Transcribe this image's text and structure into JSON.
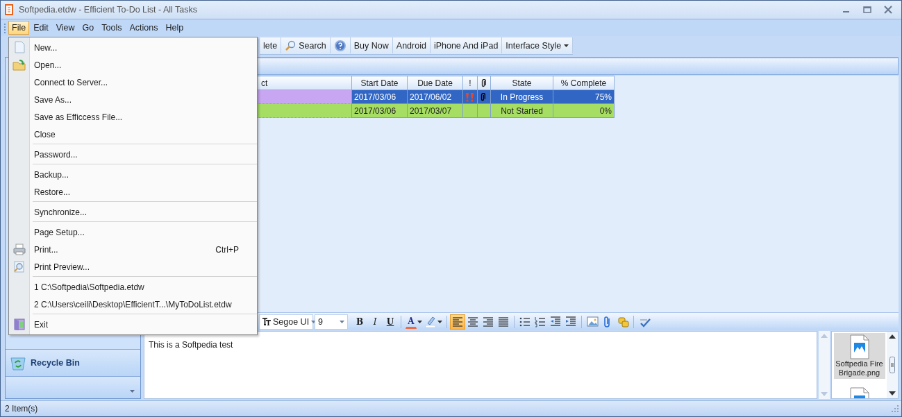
{
  "window": {
    "title": "Softpedia.etdw - Efficient To-Do List - All Tasks"
  },
  "menu_bar": [
    {
      "label": "File",
      "selected": true
    },
    {
      "label": "Edit",
      "selected": false
    },
    {
      "label": "View",
      "selected": false
    },
    {
      "label": "Go",
      "selected": false
    },
    {
      "label": "Tools",
      "selected": false
    },
    {
      "label": "Actions",
      "selected": false
    },
    {
      "label": "Help",
      "selected": false
    }
  ],
  "toolbar": [
    {
      "kind": "text",
      "label": "lete"
    },
    {
      "kind": "icon-text",
      "label": "Search"
    },
    {
      "kind": "icon"
    },
    {
      "kind": "text",
      "label": "Buy Now"
    },
    {
      "kind": "text",
      "label": "Android"
    },
    {
      "kind": "text",
      "label": "iPhone And iPad"
    },
    {
      "kind": "dropdown",
      "label": "Interface Style"
    }
  ],
  "file_menu": [
    {
      "kind": "item",
      "label": "New..."
    },
    {
      "kind": "item",
      "label": "Open..."
    },
    {
      "kind": "item",
      "label": "Connect to Server..."
    },
    {
      "kind": "item",
      "label": "Save As..."
    },
    {
      "kind": "item",
      "label": "Save as Efficcess File..."
    },
    {
      "kind": "item",
      "label": "Close"
    },
    {
      "kind": "separator"
    },
    {
      "kind": "item",
      "label": "Password..."
    },
    {
      "kind": "separator"
    },
    {
      "kind": "item",
      "label": "Backup..."
    },
    {
      "kind": "item",
      "label": "Restore..."
    },
    {
      "kind": "separator"
    },
    {
      "kind": "item",
      "label": "Synchronize..."
    },
    {
      "kind": "separator"
    },
    {
      "kind": "item",
      "label": "Page Setup..."
    },
    {
      "kind": "item",
      "label": "Print...",
      "shortcut": "Ctrl+P"
    },
    {
      "kind": "item",
      "label": "Print Preview..."
    },
    {
      "kind": "separator"
    },
    {
      "kind": "item",
      "label": "1 C:\\Softpedia\\Softpedia.etdw"
    },
    {
      "kind": "item",
      "label": "2 C:\\Users\\ceili\\Desktop\\EfficientT...\\MyToDoList.etdw"
    },
    {
      "kind": "separator"
    },
    {
      "kind": "item",
      "label": "Exit"
    }
  ],
  "table": {
    "columns": [
      "ct",
      "Start Date",
      "Due Date",
      "!",
      "",
      "State",
      "% Complete"
    ],
    "rows": [
      {
        "selected": true,
        "color": "#c8a6f2",
        "start_date": "2017/03/06",
        "due_date": "2017/06/02",
        "high_priority": true,
        "attachment": true,
        "state": "In Progress",
        "complete": "75%"
      },
      {
        "selected": false,
        "color": "#a6de64",
        "start_date": "2017/03/06",
        "due_date": "2017/03/07",
        "high_priority": false,
        "attachment": false,
        "state": "Not Started",
        "complete": "0%"
      }
    ]
  },
  "sidebar": {
    "items": [
      {
        "label": "Recycle Bin"
      }
    ]
  },
  "editor_toolbar": {
    "font": "Segoe UI",
    "size": "9",
    "buttons": [
      {
        "kind": "bold",
        "label": "B",
        "selected": false
      },
      {
        "kind": "italic",
        "label": "I",
        "selected": false
      },
      {
        "kind": "underline",
        "label": "U",
        "selected": false
      },
      {
        "kind": "separator"
      },
      {
        "kind": "font-color",
        "label": "A",
        "selected": false
      },
      {
        "kind": "highlight",
        "selected": false
      },
      {
        "kind": "separator"
      },
      {
        "kind": "align-left",
        "selected": true
      },
      {
        "kind": "align-center",
        "selected": false
      },
      {
        "kind": "align-right",
        "selected": false
      },
      {
        "kind": "justify",
        "selected": false
      },
      {
        "kind": "separator"
      },
      {
        "kind": "bullets",
        "selected": false
      },
      {
        "kind": "numbering",
        "selected": false
      },
      {
        "kind": "outdent",
        "selected": false
      },
      {
        "kind": "indent",
        "selected": false
      },
      {
        "kind": "separator"
      },
      {
        "kind": "image",
        "selected": false
      },
      {
        "kind": "attach",
        "selected": false
      },
      {
        "kind": "link",
        "selected": false
      },
      {
        "kind": "separator"
      },
      {
        "kind": "spellcheck",
        "selected": false
      }
    ]
  },
  "editor": {
    "text": "This is a Softpedia test"
  },
  "attachments": [
    {
      "name": "Softpedia Fire Brigade.png",
      "selected": true
    },
    {
      "selected": false
    }
  ],
  "status_bar": {
    "text": "2 Item(s)"
  }
}
